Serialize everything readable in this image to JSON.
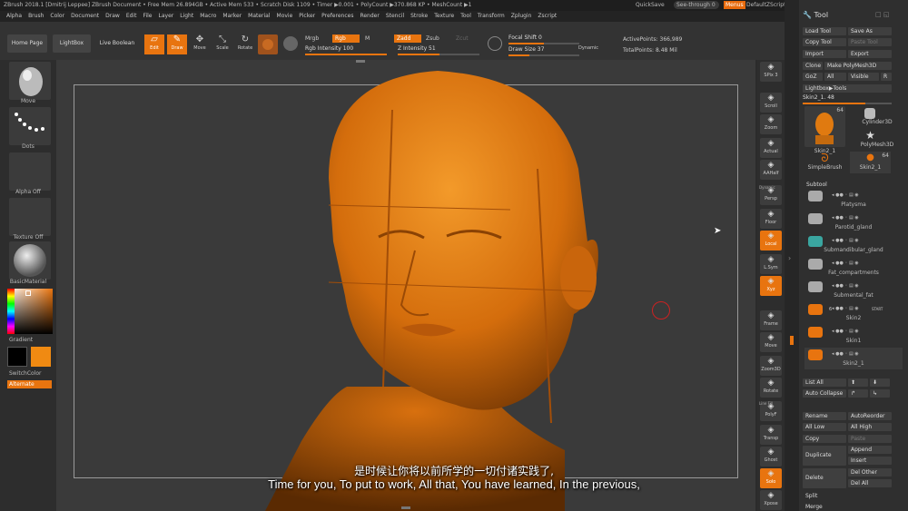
{
  "titlebar": {
    "title": "ZBrush 2018.1 [Dmitrij Leppee]   ZBrush Document     • Free Mem 26.894GB • Active Mem 533 • Scratch Disk 1109 • Timer ▶0.001 • PolyCount ▶370.868 KP • MeshCount ▶1",
    "quicksave": "QuickSave",
    "seethrough": "See-through  0",
    "menus": "Menus",
    "default_zscript": "DefaultZScript"
  },
  "menubar": [
    "Alpha",
    "Brush",
    "Color",
    "Document",
    "Draw",
    "Edit",
    "File",
    "Layer",
    "Light",
    "Macro",
    "Marker",
    "Material",
    "Movie",
    "Picker",
    "Preferences",
    "Render",
    "Stencil",
    "Stroke",
    "Texture",
    "Tool",
    "Transform",
    "Zplugin",
    "Zscript"
  ],
  "toolbar": {
    "home_page": "Home Page",
    "lightbox": "LightBox",
    "live_boolean": "Live Boolean",
    "edit": "Edit",
    "draw": "Draw",
    "move": "Move",
    "scale": "Scale",
    "rotate": "Rotate",
    "mrgb": "Mrgb",
    "rgb": "Rgb",
    "m": "M",
    "rgb_intensity": "Rgb Intensity 100",
    "zadd": "Zadd",
    "zsub": "Zsub",
    "zcut": "Zcut",
    "z_intensity": "Z Intensity 51",
    "focal_shift": "Focal Shift 0",
    "draw_size": "Draw Size 37",
    "dynamic": "Dynamic",
    "active_points": "ActivePoints: 366,989",
    "total_points": "TotalPoints: 8.48 Mil"
  },
  "left_shelf": {
    "brush": "Move",
    "stroke": "Dots",
    "alpha": "Alpha Off",
    "texture": "Texture Off",
    "material": "BasicMaterial",
    "gradient": "Gradient",
    "switch_color": "SwitchColor",
    "alternate": "Alternate"
  },
  "right_shelf": [
    {
      "label": "SPix 3",
      "icon": "bpr-sphere-icon"
    },
    {
      "label": "Scroll",
      "icon": "scroll-icon"
    },
    {
      "label": "Zoom",
      "icon": "zoom-icon"
    },
    {
      "label": "Actual",
      "icon": "actual-icon"
    },
    {
      "label": "AAHalf",
      "icon": "aahalf-icon"
    },
    {
      "label": "Persp",
      "icon": "persp-icon"
    },
    {
      "label": "Floor",
      "icon": "floor-icon"
    },
    {
      "label": "Local",
      "icon": "local-icon"
    },
    {
      "label": "L.Sym",
      "icon": "lsym-icon"
    },
    {
      "label": "Xyz",
      "icon": "xyz-icon"
    },
    {
      "label": "Frame",
      "icon": "frame-icon"
    },
    {
      "label": "Move",
      "icon": "move-icon"
    },
    {
      "label": "Zoom3D",
      "icon": "zoom3d-icon"
    },
    {
      "label": "Rotate",
      "icon": "rotate-icon"
    },
    {
      "label": "PolyF",
      "icon": "polyf-icon"
    },
    {
      "label": "Transp",
      "icon": "transp-icon"
    },
    {
      "label": "Ghost",
      "icon": "ghost-icon"
    },
    {
      "label": "Solo",
      "icon": "solo-icon"
    },
    {
      "label": "Xpose",
      "icon": "xpose-icon"
    }
  ],
  "right_shelf_extra": {
    "dynamic": "Dynamic",
    "line_fill": "Line Fill"
  },
  "tool_panel": {
    "title": "Tool",
    "load_tool": "Load Tool",
    "save_as": "Save As",
    "copy_tool": "Copy Tool",
    "paste_tool": "Paste Tool",
    "import": "Import",
    "export": "Export",
    "clone": "Clone",
    "make_polymesh": "Make PolyMesh3D",
    "goz": "GoZ",
    "all": "All",
    "visible": "Visible",
    "r": "R",
    "lightbox_tools": "Lightbox▶Tools",
    "skin_slider": "Skin2_1. 48",
    "thumbs": [
      {
        "name": "Skin2_1",
        "count": "64"
      },
      {
        "name": "Cylinder3D",
        "count": ""
      },
      {
        "name": "PolyMesh3D",
        "count": ""
      },
      {
        "name": "SimpleBrush",
        "count": ""
      },
      {
        "name": "Skin2_1",
        "count": "64"
      }
    ],
    "subtool_title": "Subtool",
    "subtools": [
      "Platysma",
      "Parotid_gland",
      "Submandibular_gland",
      "Fat_compartments",
      "Submental_fat",
      "Skin2",
      "Skin1",
      "Skin2_1"
    ],
    "subtool_extra": {
      "six": "6",
      "start": "START"
    },
    "list_all": "List All",
    "auto_collapse": "Auto Collapse",
    "rename": "Rename",
    "auto_reorder": "AutoReorder",
    "all_low": "All Low",
    "all_high": "All High",
    "copy": "Copy",
    "paste": "Paste",
    "duplicate": "Duplicate",
    "append": "Append",
    "insert": "Insert",
    "delete": "Delete",
    "del_other": "Del Other",
    "del_all": "Del All",
    "split": "Split",
    "merge": "Merge"
  },
  "subtitles": {
    "cn": "是时候让你将以前所学的一切付诸实践了,",
    "en": "Time for you, To put to work, All that, You have learned, In the previous,"
  },
  "colors": {
    "accent": "#e8740f",
    "model": "#e07a10",
    "background": "#3a3a3a"
  }
}
